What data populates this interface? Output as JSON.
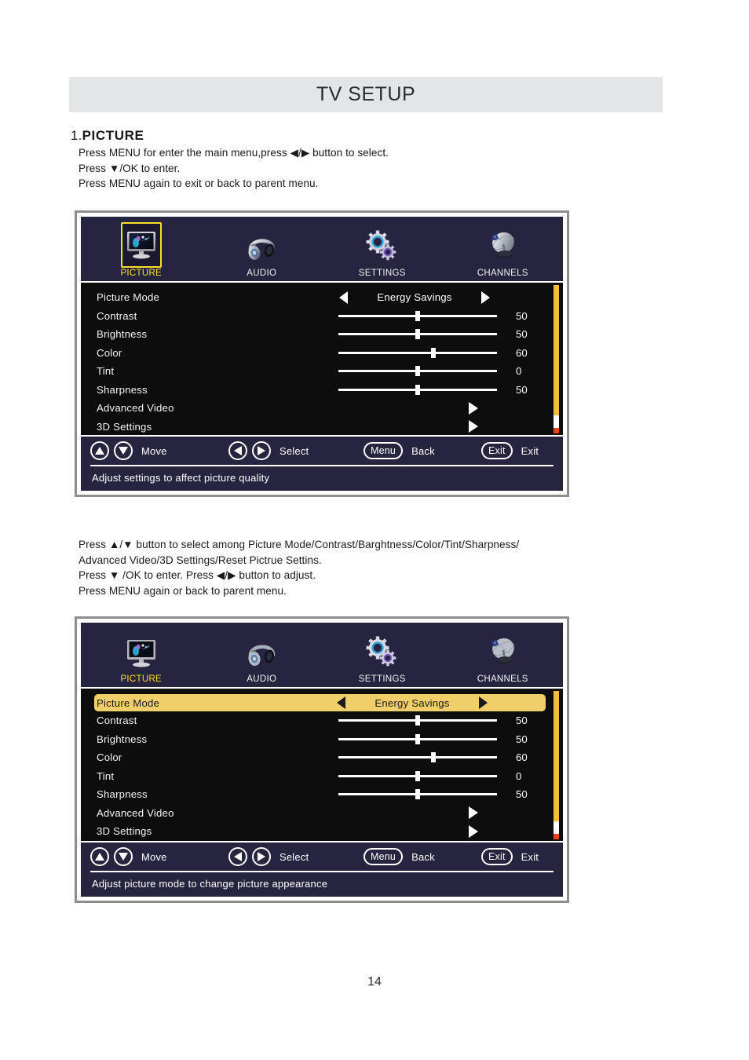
{
  "header": {
    "title": "TV SETUP"
  },
  "section": {
    "number": "1.",
    "title": "PICTURE"
  },
  "instructions": {
    "top": "Press MENU for enter the main menu,press ◀/▶ button to select.\nPress ▼/OK to enter.\nPress MENU again to exit or back to parent menu.",
    "middle": "Press ▲/▼ button to select among Picture Mode/Contrast/Barghtness/Color/Tint/Sharpness/\nAdvanced Video/3D Settings/Reset Pictrue Settins.\nPress ▼ /OK to enter. Press ◀/▶ button to adjust.\nPress MENU again or back to parent menu."
  },
  "osd": {
    "tabs": [
      {
        "label": "PICTURE",
        "icon": "monitor-icon",
        "selected": true
      },
      {
        "label": "AUDIO",
        "icon": "headphones-icon",
        "selected": false
      },
      {
        "label": "SETTINGS",
        "icon": "gears-icon",
        "selected": false
      },
      {
        "label": "CHANNELS",
        "icon": "satellite-dish-icon",
        "selected": false
      }
    ],
    "rows": [
      {
        "label": "Picture Mode",
        "type": "choice",
        "value": "Energy Savings"
      },
      {
        "label": "Contrast",
        "type": "slider",
        "value": "50",
        "percent": 50
      },
      {
        "label": "Brightness",
        "type": "slider",
        "value": "50",
        "percent": 50
      },
      {
        "label": "Color",
        "type": "slider",
        "value": "60",
        "percent": 60
      },
      {
        "label": "Tint",
        "type": "slider",
        "value": "0",
        "percent": 50
      },
      {
        "label": "Sharpness",
        "type": "slider",
        "value": "50",
        "percent": 50
      },
      {
        "label": "Advanced Video",
        "type": "submenu"
      },
      {
        "label": "3D Settings",
        "type": "submenu"
      }
    ],
    "legend": [
      {
        "key": "up-down-arrows",
        "label": "Move"
      },
      {
        "key": "left-right-arrows",
        "label": "Select"
      },
      {
        "key": "Menu",
        "label": "Back"
      },
      {
        "key": "Exit",
        "label": "Exit"
      }
    ],
    "hint_panel_1": "Adjust settings to affect picture quality",
    "hint_panel_2": "Adjust picture mode to change picture appearance"
  },
  "colors": {
    "header_bg": "#e2e6e6",
    "osd_tab_bg": "#272440",
    "osd_list_bg": "#0d0d0d",
    "highlight": "#f0cf6b",
    "selected_label": "#f7e02a",
    "scroll_thumb": "#f0bf39",
    "scroll_marker": "#e8421c"
  },
  "page_number": "14"
}
